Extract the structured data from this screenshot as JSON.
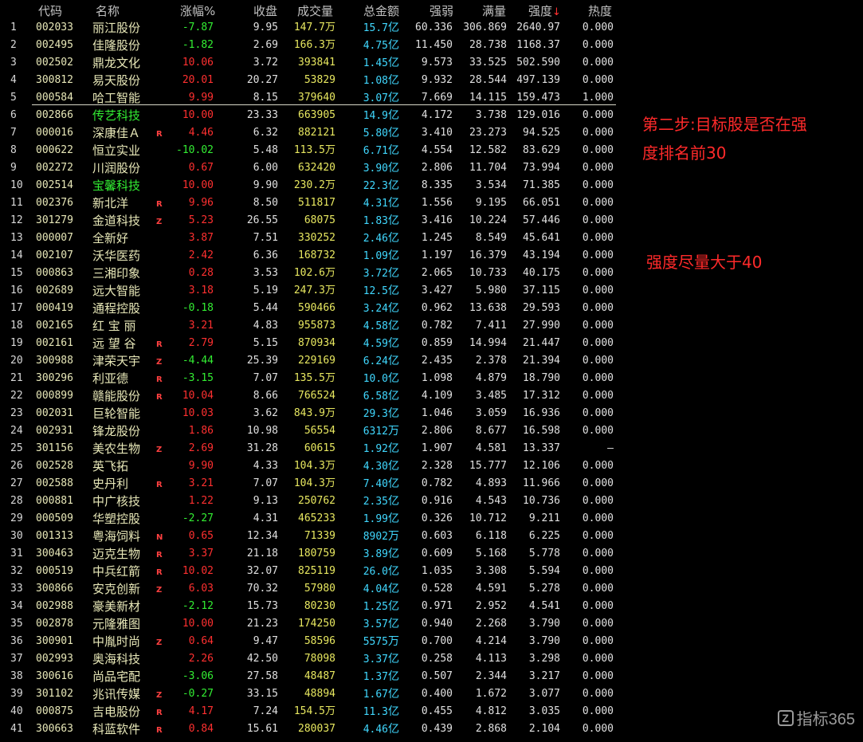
{
  "header": {
    "code": "代码",
    "name": "名称",
    "change_pct": "涨幅%",
    "close": "收盘",
    "volume": "成交量",
    "amount": "总金额",
    "strength_weak": "强弱",
    "full": "满量",
    "strength": "强度",
    "strength_sort": "↓",
    "heat": "热度"
  },
  "annotations": {
    "step2_line1": "第二步:目标股是否在强",
    "step2_line2": "度排名前30",
    "strength_hint": "强度尽量大于40"
  },
  "logo": {
    "icon": "Z",
    "text": "指标365"
  },
  "rows": [
    {
      "idx": "1",
      "code": "002033",
      "name": "丽江股份",
      "tag": "",
      "chg": "-7.87",
      "close": "9.95",
      "vol": "147.7",
      "vol_u": "万",
      "amt": "15.7",
      "amt_u": "亿",
      "qr": "60.336",
      "mal": "306.869",
      "qd": "2640.97",
      "rd": "0.000",
      "dir": "dn"
    },
    {
      "idx": "2",
      "code": "002495",
      "name": "佳隆股份",
      "tag": "",
      "chg": "-1.82",
      "close": "2.69",
      "vol": "166.3",
      "vol_u": "万",
      "amt": "4.75",
      "amt_u": "亿",
      "qr": "11.450",
      "mal": "28.738",
      "qd": "1168.37",
      "rd": "0.000",
      "dir": "dn"
    },
    {
      "idx": "3",
      "code": "002502",
      "name": "鼎龙文化",
      "tag": "",
      "chg": "10.06",
      "close": "3.72",
      "vol": "393841",
      "vol_u": "",
      "amt": "1.45",
      "amt_u": "亿",
      "qr": "9.573",
      "mal": "33.525",
      "qd": "502.590",
      "rd": "0.000",
      "dir": "up"
    },
    {
      "idx": "4",
      "code": "300812",
      "name": "易天股份",
      "tag": "",
      "chg": "20.01",
      "close": "20.27",
      "vol": "53829",
      "vol_u": "",
      "amt": "1.08",
      "amt_u": "亿",
      "qr": "9.932",
      "mal": "28.544",
      "qd": "497.139",
      "rd": "0.000",
      "dir": "up"
    },
    {
      "idx": "5",
      "code": "000584",
      "name": "哈工智能",
      "tag": "",
      "chg": "9.99",
      "close": "8.15",
      "vol": "379640",
      "vol_u": "",
      "amt": "3.07",
      "amt_u": "亿",
      "qr": "7.669",
      "mal": "14.115",
      "qd": "159.473",
      "rd": "1.000",
      "dir": "up"
    },
    {
      "idx": "6",
      "code": "002866",
      "name": "传艺科技",
      "tag": "",
      "chg": "10.00",
      "close": "23.33",
      "vol": "663905",
      "vol_u": "",
      "amt": "14.9",
      "amt_u": "亿",
      "qr": "4.172",
      "mal": "3.738",
      "qd": "129.016",
      "rd": "0.000",
      "dir": "up",
      "lt": true
    },
    {
      "idx": "7",
      "code": "000016",
      "name": "深康佳Ａ",
      "tag": "R",
      "chg": "4.46",
      "close": "6.32",
      "vol": "882121",
      "vol_u": "",
      "amt": "5.80",
      "amt_u": "亿",
      "qr": "3.410",
      "mal": "23.273",
      "qd": "94.525",
      "rd": "0.000",
      "dir": "up"
    },
    {
      "idx": "8",
      "code": "000622",
      "name": "恒立实业",
      "tag": "",
      "chg": "-10.02",
      "close": "5.48",
      "vol": "113.5",
      "vol_u": "万",
      "amt": "6.71",
      "amt_u": "亿",
      "qr": "4.554",
      "mal": "12.582",
      "qd": "83.629",
      "rd": "0.000",
      "dir": "dn"
    },
    {
      "idx": "9",
      "code": "002272",
      "name": "川润股份",
      "tag": "",
      "chg": "0.67",
      "close": "6.00",
      "vol": "632420",
      "vol_u": "",
      "amt": "3.90",
      "amt_u": "亿",
      "qr": "2.806",
      "mal": "11.704",
      "qd": "73.994",
      "rd": "0.000",
      "dir": "up"
    },
    {
      "idx": "10",
      "code": "002514",
      "name": "宝馨科技",
      "tag": "",
      "chg": "10.00",
      "close": "9.90",
      "vol": "230.2",
      "vol_u": "万",
      "amt": "22.3",
      "amt_u": "亿",
      "qr": "8.335",
      "mal": "3.534",
      "qd": "71.385",
      "rd": "0.000",
      "dir": "up",
      "lt": true
    },
    {
      "idx": "11",
      "code": "002376",
      "name": "新北洋",
      "tag": "R",
      "chg": "9.96",
      "close": "8.50",
      "vol": "511817",
      "vol_u": "",
      "amt": "4.31",
      "amt_u": "亿",
      "qr": "1.556",
      "mal": "9.195",
      "qd": "66.051",
      "rd": "0.000",
      "dir": "up"
    },
    {
      "idx": "12",
      "code": "301279",
      "name": "金道科技",
      "tag": "Z",
      "chg": "5.23",
      "close": "26.55",
      "vol": "68075",
      "vol_u": "",
      "amt": "1.83",
      "amt_u": "亿",
      "qr": "3.416",
      "mal": "10.224",
      "qd": "57.446",
      "rd": "0.000",
      "dir": "up"
    },
    {
      "idx": "13",
      "code": "000007",
      "name": "全新好",
      "tag": "",
      "chg": "3.87",
      "close": "7.51",
      "vol": "330252",
      "vol_u": "",
      "amt": "2.46",
      "amt_u": "亿",
      "qr": "1.245",
      "mal": "8.549",
      "qd": "45.641",
      "rd": "0.000",
      "dir": "up"
    },
    {
      "idx": "14",
      "code": "002107",
      "name": "沃华医药",
      "tag": "",
      "chg": "2.42",
      "close": "6.36",
      "vol": "168732",
      "vol_u": "",
      "amt": "1.09",
      "amt_u": "亿",
      "qr": "1.197",
      "mal": "16.379",
      "qd": "43.194",
      "rd": "0.000",
      "dir": "up"
    },
    {
      "idx": "15",
      "code": "000863",
      "name": "三湘印象",
      "tag": "",
      "chg": "0.28",
      "close": "3.53",
      "vol": "102.6",
      "vol_u": "万",
      "amt": "3.72",
      "amt_u": "亿",
      "qr": "2.065",
      "mal": "10.733",
      "qd": "40.175",
      "rd": "0.000",
      "dir": "up"
    },
    {
      "idx": "16",
      "code": "002689",
      "name": "远大智能",
      "tag": "",
      "chg": "3.18",
      "close": "5.19",
      "vol": "247.3",
      "vol_u": "万",
      "amt": "12.5",
      "amt_u": "亿",
      "qr": "3.427",
      "mal": "5.980",
      "qd": "37.115",
      "rd": "0.000",
      "dir": "up"
    },
    {
      "idx": "17",
      "code": "000419",
      "name": "通程控股",
      "tag": "",
      "chg": "-0.18",
      "close": "5.44",
      "vol": "590466",
      "vol_u": "",
      "amt": "3.24",
      "amt_u": "亿",
      "qr": "0.962",
      "mal": "13.638",
      "qd": "29.593",
      "rd": "0.000",
      "dir": "dn"
    },
    {
      "idx": "18",
      "code": "002165",
      "name": "红 宝 丽",
      "tag": "",
      "chg": "3.21",
      "close": "4.83",
      "vol": "955873",
      "vol_u": "",
      "amt": "4.58",
      "amt_u": "亿",
      "qr": "0.782",
      "mal": "7.411",
      "qd": "27.990",
      "rd": "0.000",
      "dir": "up"
    },
    {
      "idx": "19",
      "code": "002161",
      "name": "远 望 谷",
      "tag": "R",
      "chg": "2.79",
      "close": "5.15",
      "vol": "870934",
      "vol_u": "",
      "amt": "4.59",
      "amt_u": "亿",
      "qr": "0.859",
      "mal": "14.994",
      "qd": "21.447",
      "rd": "0.000",
      "dir": "up"
    },
    {
      "idx": "20",
      "code": "300988",
      "name": "津荣天宇",
      "tag": "Z",
      "chg": "-4.44",
      "close": "25.39",
      "vol": "229169",
      "vol_u": "",
      "amt": "6.24",
      "amt_u": "亿",
      "qr": "2.435",
      "mal": "2.378",
      "qd": "21.394",
      "rd": "0.000",
      "dir": "dn"
    },
    {
      "idx": "21",
      "code": "300296",
      "name": "利亚德",
      "tag": "R",
      "chg": "-3.15",
      "close": "7.07",
      "vol": "135.5",
      "vol_u": "万",
      "amt": "10.0",
      "amt_u": "亿",
      "qr": "1.098",
      "mal": "4.879",
      "qd": "18.790",
      "rd": "0.000",
      "dir": "dn"
    },
    {
      "idx": "22",
      "code": "000899",
      "name": "赣能股份",
      "tag": "R",
      "chg": "10.04",
      "close": "8.66",
      "vol": "766524",
      "vol_u": "",
      "amt": "6.58",
      "amt_u": "亿",
      "qr": "4.109",
      "mal": "3.485",
      "qd": "17.312",
      "rd": "0.000",
      "dir": "up"
    },
    {
      "idx": "23",
      "code": "002031",
      "name": "巨轮智能",
      "tag": "",
      "chg": "10.03",
      "close": "3.62",
      "vol": "843.9",
      "vol_u": "万",
      "amt": "29.3",
      "amt_u": "亿",
      "qr": "1.046",
      "mal": "3.059",
      "qd": "16.936",
      "rd": "0.000",
      "dir": "up"
    },
    {
      "idx": "24",
      "code": "002931",
      "name": "锋龙股份",
      "tag": "",
      "chg": "1.86",
      "close": "10.98",
      "vol": "56554",
      "vol_u": "",
      "amt": "6312",
      "amt_u": "万",
      "qr": "2.806",
      "mal": "8.677",
      "qd": "16.598",
      "rd": "0.000",
      "dir": "up"
    },
    {
      "idx": "25",
      "code": "301156",
      "name": "美农生物",
      "tag": "Z",
      "chg": "2.69",
      "close": "31.28",
      "vol": "60615",
      "vol_u": "",
      "amt": "1.92",
      "amt_u": "亿",
      "qr": "1.907",
      "mal": "4.581",
      "qd": "13.337",
      "rd": "—",
      "dir": "up"
    },
    {
      "idx": "26",
      "code": "002528",
      "name": "英飞拓",
      "tag": "",
      "chg": "9.90",
      "close": "4.33",
      "vol": "104.3",
      "vol_u": "万",
      "amt": "4.30",
      "amt_u": "亿",
      "qr": "2.328",
      "mal": "15.777",
      "qd": "12.106",
      "rd": "0.000",
      "dir": "up"
    },
    {
      "idx": "27",
      "code": "002588",
      "name": "史丹利",
      "tag": "R",
      "chg": "3.21",
      "close": "7.07",
      "vol": "104.3",
      "vol_u": "万",
      "amt": "7.40",
      "amt_u": "亿",
      "qr": "0.782",
      "mal": "4.893",
      "qd": "11.966",
      "rd": "0.000",
      "dir": "up"
    },
    {
      "idx": "28",
      "code": "000881",
      "name": "中广核技",
      "tag": "",
      "chg": "1.22",
      "close": "9.13",
      "vol": "250762",
      "vol_u": "",
      "amt": "2.35",
      "amt_u": "亿",
      "qr": "0.916",
      "mal": "4.543",
      "qd": "10.736",
      "rd": "0.000",
      "dir": "up"
    },
    {
      "idx": "29",
      "code": "000509",
      "name": "华塑控股",
      "tag": "",
      "chg": "-2.27",
      "close": "4.31",
      "vol": "465233",
      "vol_u": "",
      "amt": "1.99",
      "amt_u": "亿",
      "qr": "0.326",
      "mal": "10.712",
      "qd": "9.211",
      "rd": "0.000",
      "dir": "dn"
    },
    {
      "idx": "30",
      "code": "001313",
      "name": "粤海饲料",
      "tag": "N",
      "chg": "0.65",
      "close": "12.34",
      "vol": "71339",
      "vol_u": "",
      "amt": "8902",
      "amt_u": "万",
      "qr": "0.603",
      "mal": "6.118",
      "qd": "6.225",
      "rd": "0.000",
      "dir": "up"
    },
    {
      "idx": "31",
      "code": "300463",
      "name": "迈克生物",
      "tag": "R",
      "chg": "3.37",
      "close": "21.18",
      "vol": "180759",
      "vol_u": "",
      "amt": "3.89",
      "amt_u": "亿",
      "qr": "0.609",
      "mal": "5.168",
      "qd": "5.778",
      "rd": "0.000",
      "dir": "up"
    },
    {
      "idx": "32",
      "code": "000519",
      "name": "中兵红箭",
      "tag": "R",
      "chg": "10.02",
      "close": "32.07",
      "vol": "825119",
      "vol_u": "",
      "amt": "26.0",
      "amt_u": "亿",
      "qr": "1.035",
      "mal": "3.308",
      "qd": "5.594",
      "rd": "0.000",
      "dir": "up"
    },
    {
      "idx": "33",
      "code": "300866",
      "name": "安克创新",
      "tag": "Z",
      "chg": "6.03",
      "close": "70.32",
      "vol": "57980",
      "vol_u": "",
      "amt": "4.04",
      "amt_u": "亿",
      "qr": "0.528",
      "mal": "4.591",
      "qd": "5.278",
      "rd": "0.000",
      "dir": "up"
    },
    {
      "idx": "34",
      "code": "002988",
      "name": "豪美新材",
      "tag": "",
      "chg": "-2.12",
      "close": "15.73",
      "vol": "80230",
      "vol_u": "",
      "amt": "1.25",
      "amt_u": "亿",
      "qr": "0.971",
      "mal": "2.952",
      "qd": "4.541",
      "rd": "0.000",
      "dir": "dn"
    },
    {
      "idx": "35",
      "code": "002878",
      "name": "元隆雅图",
      "tag": "",
      "chg": "10.00",
      "close": "21.23",
      "vol": "174250",
      "vol_u": "",
      "amt": "3.57",
      "amt_u": "亿",
      "qr": "0.940",
      "mal": "2.268",
      "qd": "3.790",
      "rd": "0.000",
      "dir": "up"
    },
    {
      "idx": "36",
      "code": "300901",
      "name": "中胤时尚",
      "tag": "Z",
      "chg": "0.64",
      "close": "9.47",
      "vol": "58596",
      "vol_u": "",
      "amt": "5575",
      "amt_u": "万",
      "qr": "0.700",
      "mal": "4.214",
      "qd": "3.790",
      "rd": "0.000",
      "dir": "up"
    },
    {
      "idx": "37",
      "code": "002993",
      "name": "奥海科技",
      "tag": "",
      "chg": "2.26",
      "close": "42.50",
      "vol": "78098",
      "vol_u": "",
      "amt": "3.37",
      "amt_u": "亿",
      "qr": "0.258",
      "mal": "4.113",
      "qd": "3.298",
      "rd": "0.000",
      "dir": "up"
    },
    {
      "idx": "38",
      "code": "300616",
      "name": "尚品宅配",
      "tag": "",
      "chg": "-3.06",
      "close": "27.58",
      "vol": "48487",
      "vol_u": "",
      "amt": "1.37",
      "amt_u": "亿",
      "qr": "0.507",
      "mal": "2.344",
      "qd": "3.217",
      "rd": "0.000",
      "dir": "dn"
    },
    {
      "idx": "39",
      "code": "301102",
      "name": "兆讯传媒",
      "tag": "Z",
      "chg": "-0.27",
      "close": "33.15",
      "vol": "48894",
      "vol_u": "",
      "amt": "1.67",
      "amt_u": "亿",
      "qr": "0.400",
      "mal": "1.672",
      "qd": "3.077",
      "rd": "0.000",
      "dir": "dn"
    },
    {
      "idx": "40",
      "code": "000875",
      "name": "吉电股份",
      "tag": "R",
      "chg": "4.17",
      "close": "7.24",
      "vol": "154.5",
      "vol_u": "万",
      "amt": "11.3",
      "amt_u": "亿",
      "qr": "0.455",
      "mal": "4.812",
      "qd": "3.035",
      "rd": "0.000",
      "dir": "up"
    },
    {
      "idx": "41",
      "code": "300663",
      "name": "科蓝软件",
      "tag": "R",
      "chg": "0.84",
      "close": "15.61",
      "vol": "280037",
      "vol_u": "",
      "amt": "4.46",
      "amt_u": "亿",
      "qr": "0.439",
      "mal": "2.868",
      "qd": "2.104",
      "rd": "0.000",
      "dir": "up"
    }
  ]
}
